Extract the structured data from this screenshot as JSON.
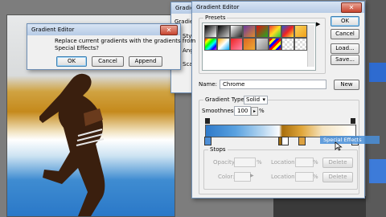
{
  "background_dialog": {
    "title": "Gradient Editor",
    "side_labels": [
      "Gradie",
      "Sty",
      "Ang",
      "Sca"
    ]
  },
  "confirm": {
    "title": "Gradient Editor",
    "message_line1": "Replace current gradients with the gradients from",
    "message_line2": "Special Effects?",
    "ok": "OK",
    "cancel": "Cancel",
    "append": "Append"
  },
  "editor": {
    "title": "Gradient Editor",
    "presets_label": "Presets",
    "ok": "OK",
    "cancel": "Cancel",
    "load": "Load...",
    "save": "Save...",
    "name_label": "Name:",
    "name_value": "Chrome",
    "new": "New",
    "gradient_type_label": "Gradient Type:",
    "gradient_type_value": "Solid",
    "smoothness_label": "Smoothness:",
    "smoothness_value": "100",
    "smoothness_unit": "%",
    "stops_label": "Stops",
    "opacity_label": "Opacity:",
    "opacity_unit": "%",
    "location_label": "Location:",
    "location_unit": "%",
    "delete": "Delete",
    "color_label": "Color:",
    "tooltip": "Special Effects"
  }
}
